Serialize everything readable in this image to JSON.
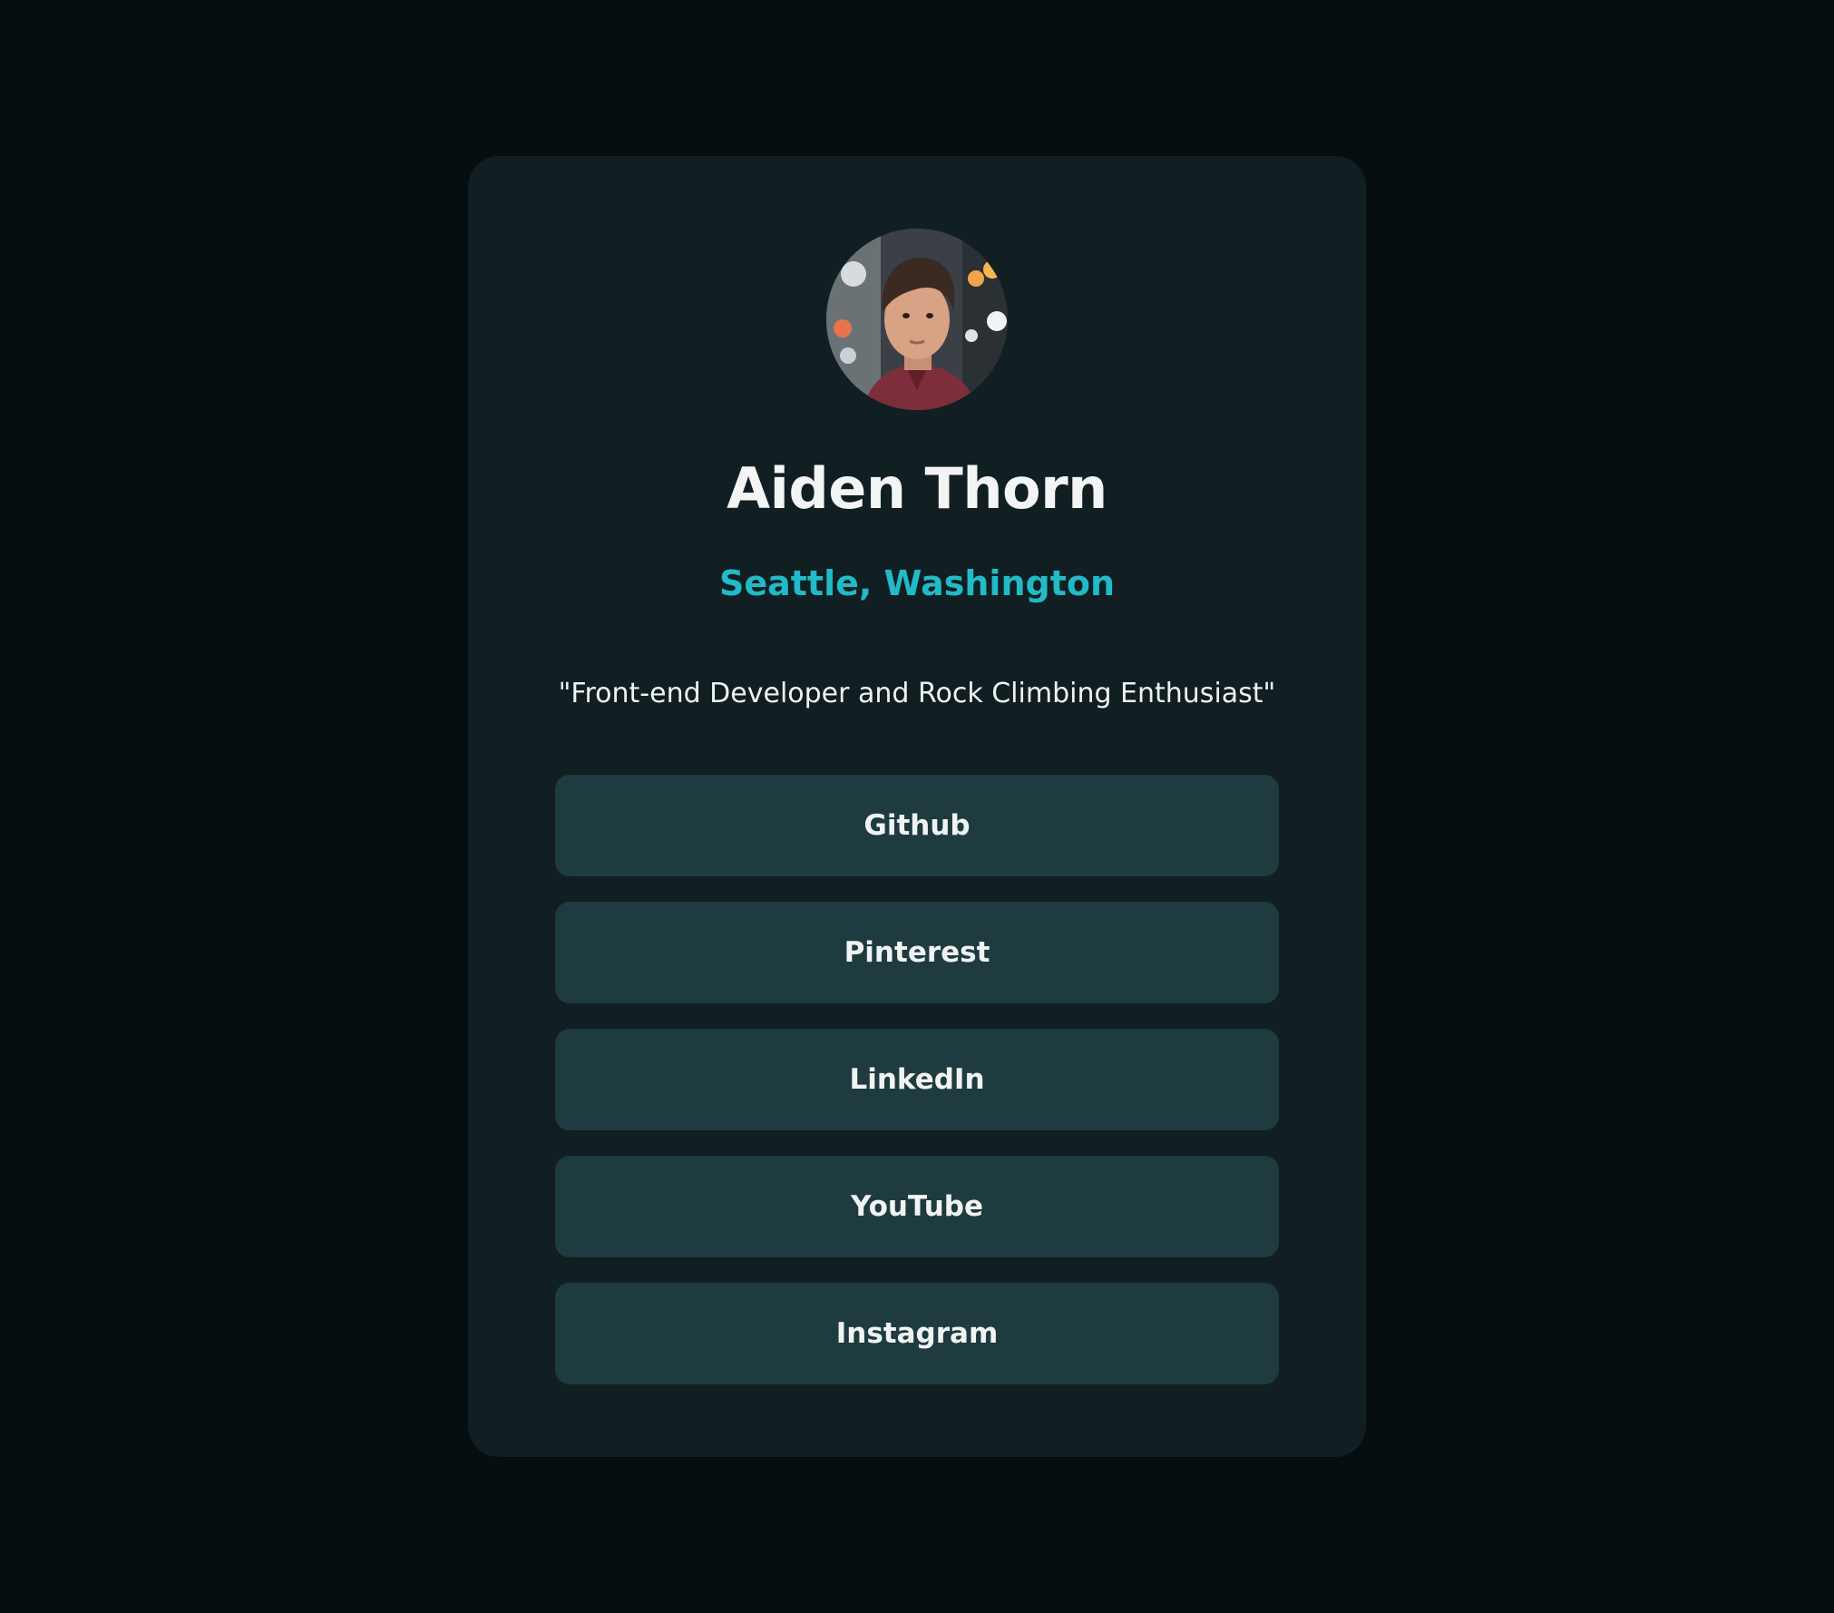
{
  "profile": {
    "name": "Aiden Thorn",
    "location": "Seattle, Washington",
    "bio": "\"Front-end Developer and Rock Climbing Enthusiast\""
  },
  "links": [
    {
      "label": "Github"
    },
    {
      "label": "Pinterest"
    },
    {
      "label": "LinkedIn"
    },
    {
      "label": "YouTube"
    },
    {
      "label": "Instagram"
    }
  ],
  "colors": {
    "page_background": "#060e0f",
    "card_background": "#111f22",
    "button_background": "#1e3b3f",
    "accent": "#22bac6",
    "text": "#f3f4f4"
  }
}
